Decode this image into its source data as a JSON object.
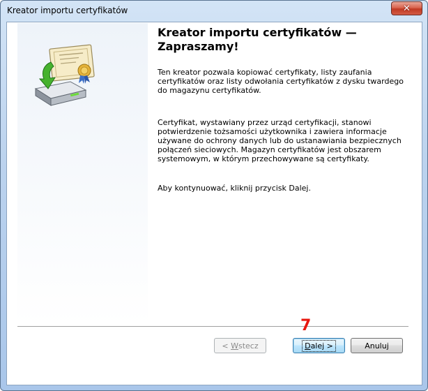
{
  "window": {
    "title": "Kreator importu certyfikatów",
    "close_icon": "close-icon",
    "colors": {
      "close_button": "#c9462f",
      "accent": "#3c7fb1"
    }
  },
  "wizard": {
    "icon": "certificate-import-icon",
    "title": "Kreator importu certyfikatów — Zapraszamy!",
    "paragraphs": [
      "Ten kreator pozwala kopiować certyfikaty, listy zaufania certyfikatów oraz listy odwołania certyfikatów z dysku twardego do magazynu certyfikatów.",
      "Certyfikat, wystawiany przez urząd certyfikacji, stanowi potwierdzenie tożsamości użytkownika i zawiera informacje używane do ochrony danych lub do ustanawiania bezpiecznych połączeń sieciowych. Magazyn certyfikatów jest obszarem systemowym, w którym przechowywane są certyfikaty.",
      "Aby kontynuować, kliknij przycisk Dalej."
    ]
  },
  "buttons": {
    "back_prefix": "< ",
    "back_mnemonic": "W",
    "back_rest": "stecz",
    "next_mnemonic": "D",
    "next_rest": "alej >",
    "cancel": "Anuluj"
  },
  "annotation": {
    "step": "7",
    "color": "#e8170f"
  }
}
